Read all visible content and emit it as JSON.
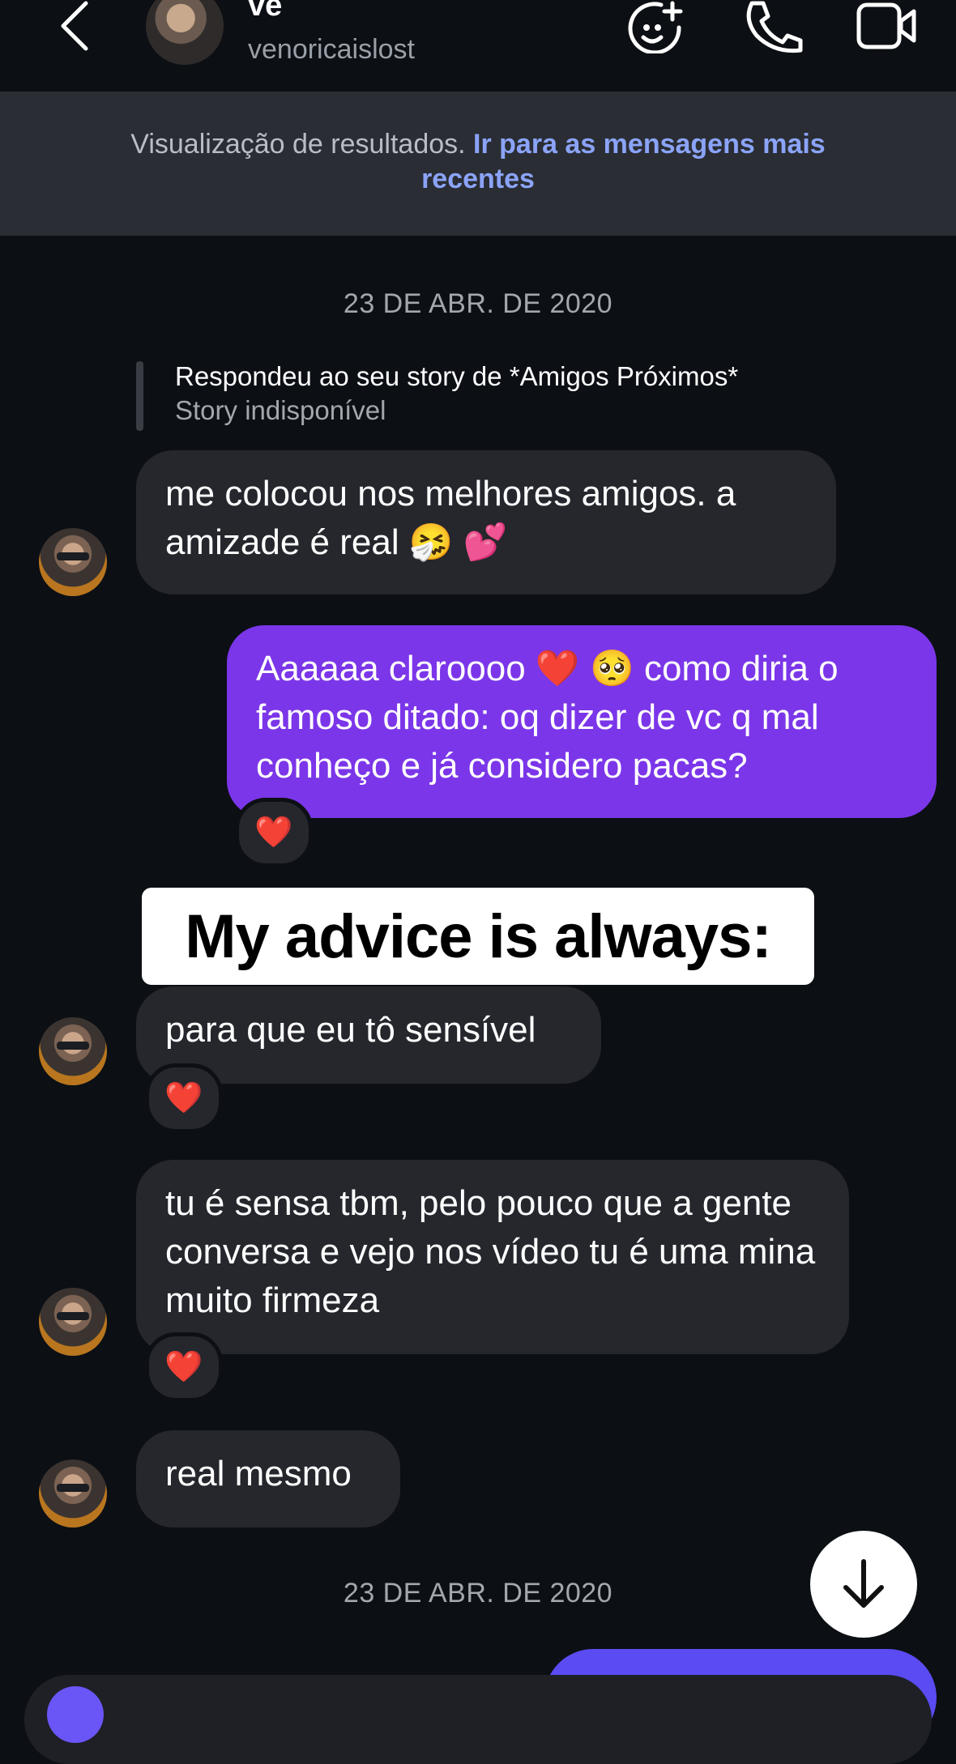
{
  "header": {
    "name": "ve",
    "username": "venoricaislost"
  },
  "banner": {
    "text": "Visualização de resultados.",
    "link": "Ir para as mensagens mais recentes"
  },
  "date_separators": [
    "23 DE ABR. DE 2020",
    "23 DE ABR. DE 2020"
  ],
  "story_reply": {
    "line1": "Respondeu ao seu story de *Amigos Próximos*",
    "line2": "Story indisponível"
  },
  "messages": [
    {
      "direction": "in",
      "text": "me colocou nos melhores amigos. a amizade é real 🤧 💕"
    },
    {
      "direction": "out",
      "text": "Aaaaaa claroooo ❤️ 🥺 como diria o famoso ditado: oq dizer de vc q mal conheço e já considero pacas?",
      "reaction": "❤️"
    },
    {
      "direction": "in",
      "text": "para que eu tô sensível",
      "reaction": "❤️"
    },
    {
      "direction": "in",
      "text": "tu é sensa tbm, pelo pouco que a gente conversa e vejo nos vídeo tu é uma mina muito firmeza",
      "reaction": "❤️"
    },
    {
      "direction": "in",
      "text": "real mesmo"
    }
  ],
  "overlay_caption": "My advice is always:",
  "icons": {
    "back": "chevron-left-icon",
    "effects": "face-plus-icon",
    "call": "phone-icon",
    "video": "video-camera-icon",
    "scroll": "arrow-down-icon"
  },
  "colors": {
    "background": "#0c0f14",
    "incoming_bubble": "#25272d",
    "outgoing_bubble": "#7b36e9",
    "link": "#8ba4f8",
    "banner": "#2a2d34"
  }
}
